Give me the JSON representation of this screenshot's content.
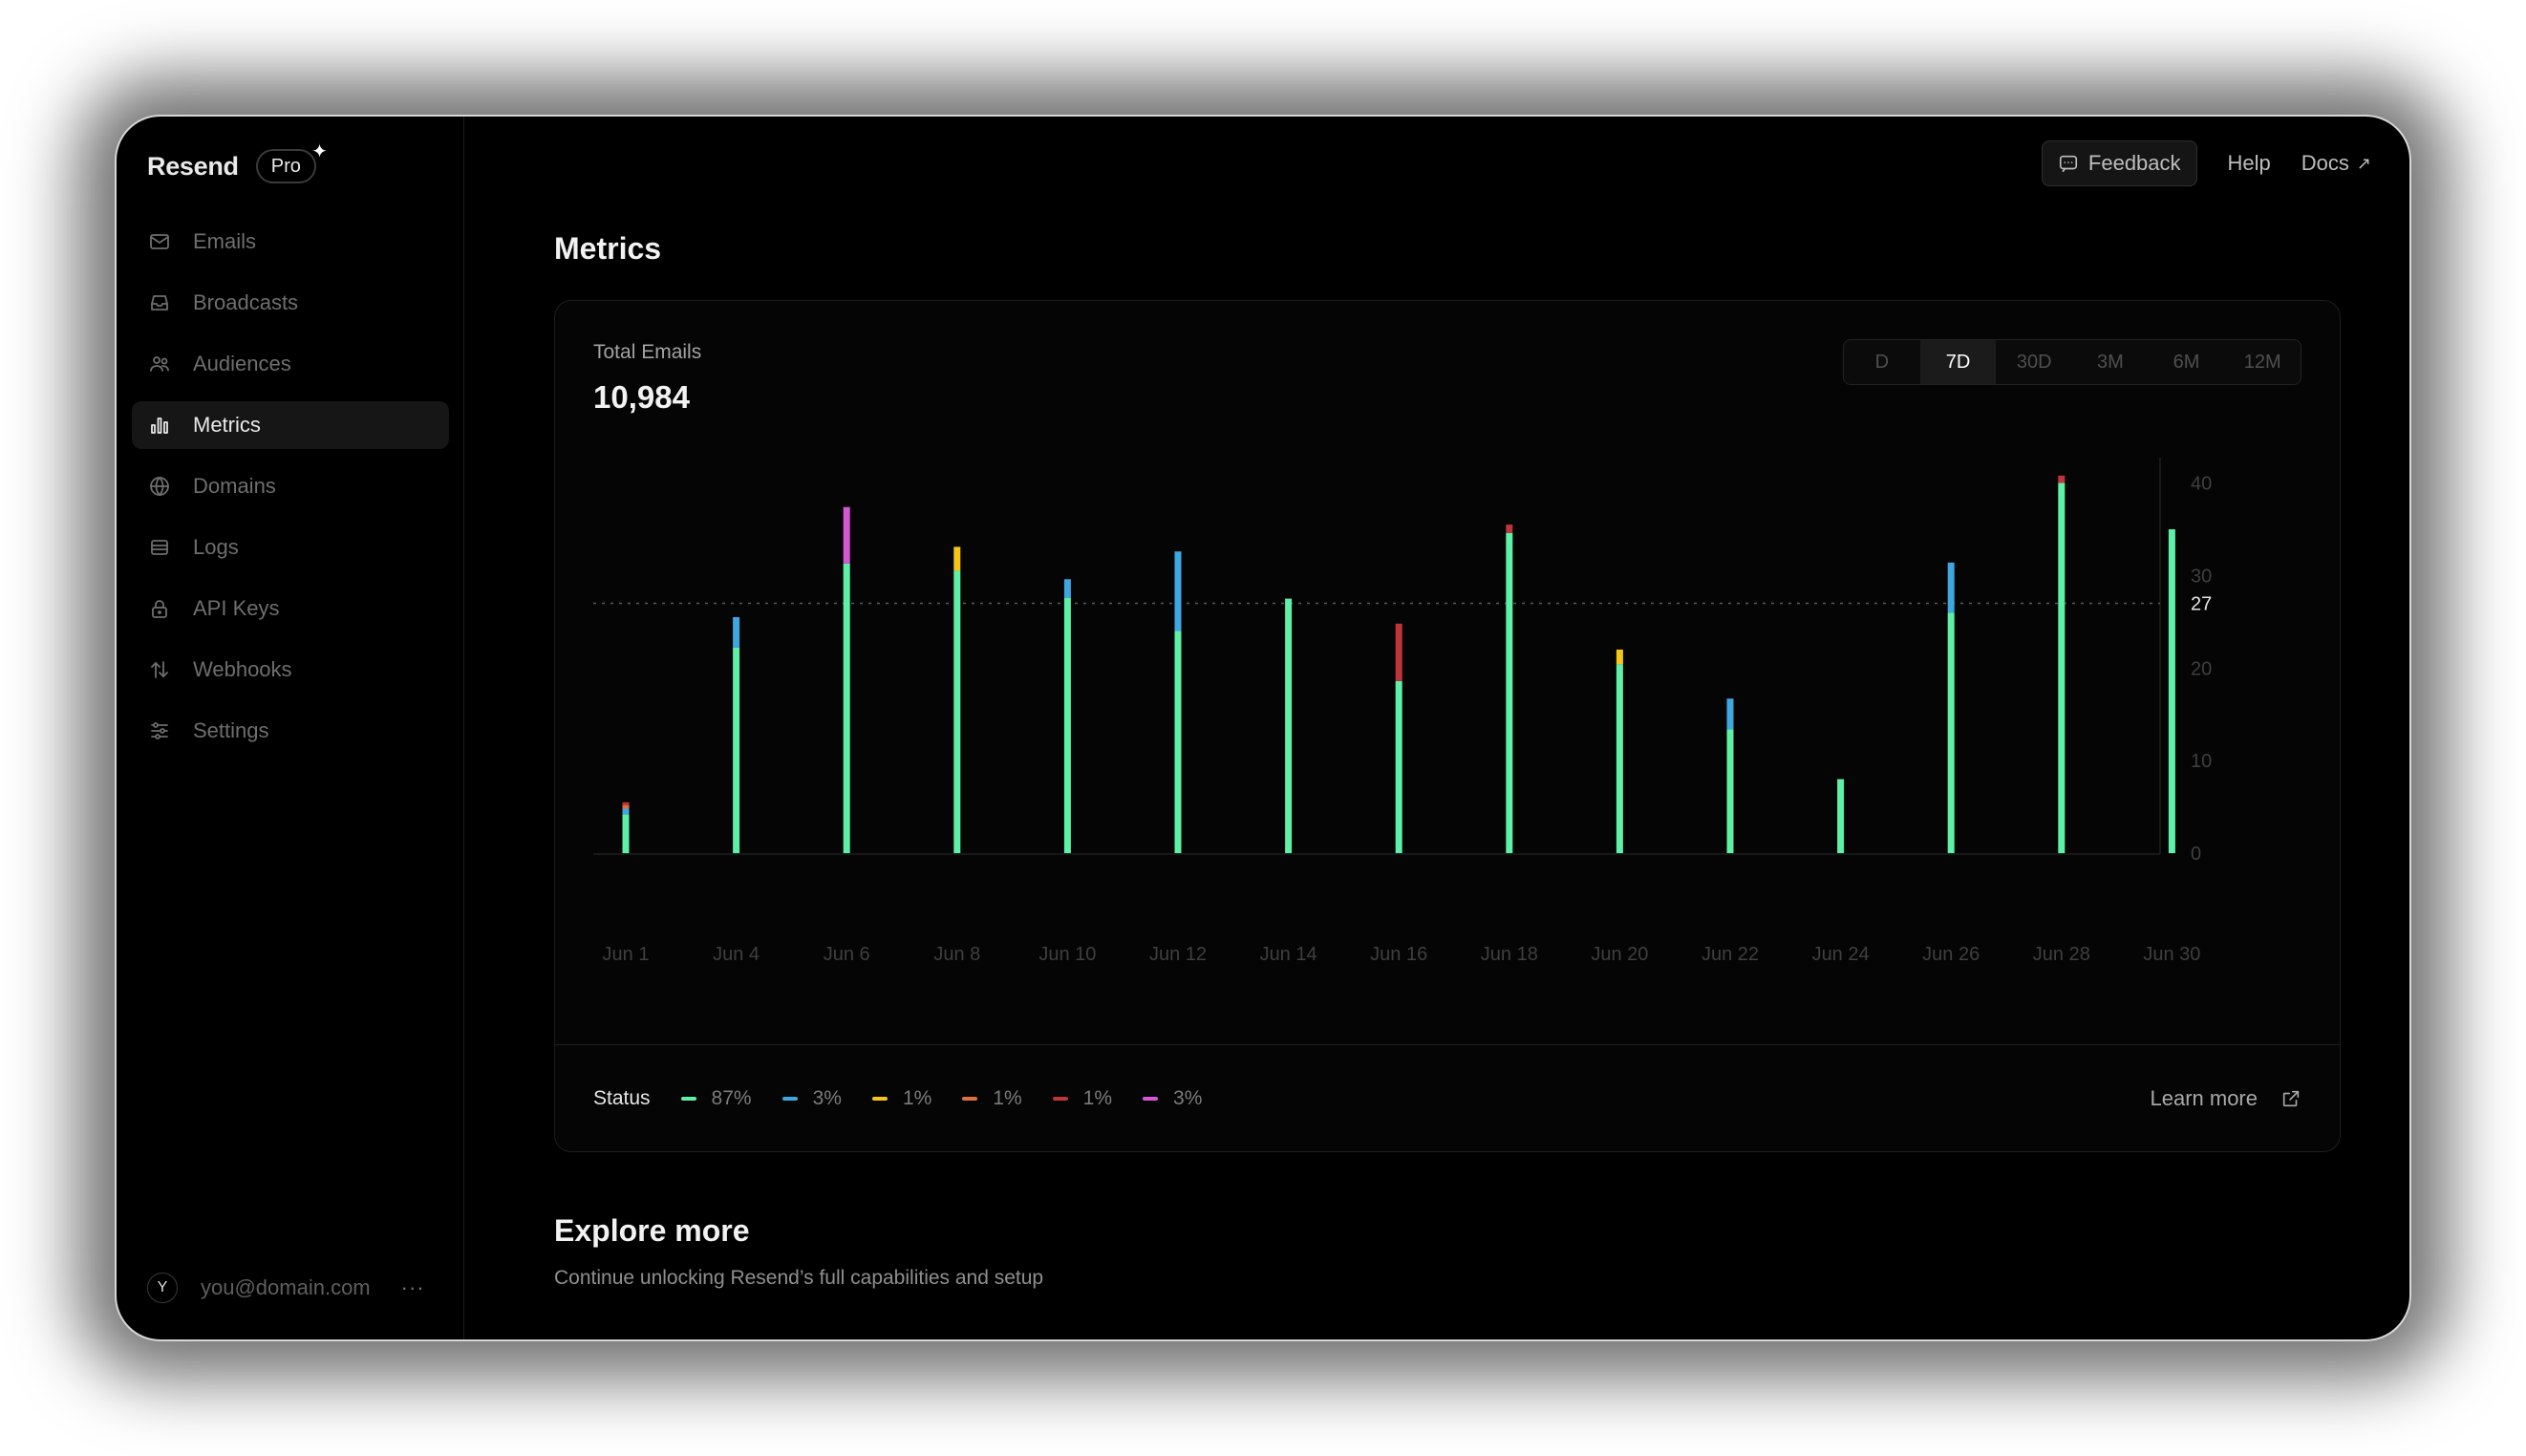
{
  "app": {
    "name": "Resend",
    "plan_badge": "Pro",
    "badge_spark_icon": "sparkle-icon"
  },
  "sidebar": {
    "items": [
      {
        "label": "Emails",
        "icon": "mail-icon",
        "active": false
      },
      {
        "label": "Broadcasts",
        "icon": "inbox-icon",
        "active": false
      },
      {
        "label": "Audiences",
        "icon": "users-icon",
        "active": false
      },
      {
        "label": "Metrics",
        "icon": "bar-chart-icon",
        "active": true
      },
      {
        "label": "Domains",
        "icon": "globe-icon",
        "active": false
      },
      {
        "label": "Logs",
        "icon": "list-icon",
        "active": false
      },
      {
        "label": "API Keys",
        "icon": "lock-icon",
        "active": false
      },
      {
        "label": "Webhooks",
        "icon": "arrows-up-down-icon",
        "active": false
      },
      {
        "label": "Settings",
        "icon": "sliders-icon",
        "active": false
      }
    ],
    "user": {
      "initial": "Y",
      "email": "you@domain.com",
      "more": "···"
    }
  },
  "topbar": {
    "feedback": "Feedback",
    "help": "Help",
    "docs": "Docs"
  },
  "page": {
    "title": "Metrics"
  },
  "card": {
    "label": "Total Emails",
    "value": "10,984",
    "ranges": [
      "D",
      "7D",
      "30D",
      "3M",
      "6M",
      "12M"
    ],
    "active_range": "7D"
  },
  "chart_data": {
    "type": "bar",
    "stacked": true,
    "categories": [
      "Jun 1",
      "Jun 4",
      "Jun 6",
      "Jun 8",
      "Jun 10",
      "Jun 12",
      "Jun 14",
      "Jun 16",
      "Jun 18",
      "Jun 20",
      "Jun 22",
      "Jun 24",
      "Jun 26",
      "Jun 28",
      "Jun 30"
    ],
    "xticks": [
      "Jun 1",
      "Jun 4",
      "Jun 6",
      "Jun 8",
      "Jun 10",
      "Jun 12",
      "Jun 14",
      "Jun 16",
      "Jun 18",
      "Jun 20",
      "Jun 22",
      "Jun 24",
      "Jun 26",
      "Jun 28",
      "Jun 30"
    ],
    "series": [
      {
        "color": "#5ff0a8",
        "values": [
          4.2,
          22.2,
          31.3,
          30.5,
          27.6,
          24.0,
          27.5,
          18.6,
          34.6,
          20.4,
          13.4,
          8.0,
          26.0,
          40.0,
          35.0
        ]
      },
      {
        "color": "#3ea7e0",
        "values": [
          0.6,
          3.3,
          0,
          0,
          2.0,
          8.6,
          0,
          0,
          0,
          0,
          3.3,
          0,
          5.4,
          0,
          0
        ]
      },
      {
        "color": "#f5c518",
        "values": [
          0,
          0,
          0,
          2.6,
          0,
          0,
          0,
          0,
          0,
          1.6,
          0,
          0,
          0,
          0,
          0
        ]
      },
      {
        "color": "#e0713c",
        "values": [
          0.4,
          0,
          0,
          0,
          0,
          0,
          0,
          0,
          0,
          0,
          0,
          0,
          0,
          0,
          0
        ]
      },
      {
        "color": "#c0353a",
        "values": [
          0.3,
          0,
          0,
          0,
          0,
          0,
          0,
          6.2,
          0.9,
          0,
          0,
          0,
          0,
          0.8,
          0
        ]
      },
      {
        "color": "#d458d4",
        "values": [
          0,
          0,
          6.1,
          0,
          0,
          0,
          0,
          0,
          0,
          0,
          0,
          0,
          0,
          0,
          0
        ]
      }
    ],
    "yticks": [
      0,
      10,
      20,
      30,
      40
    ],
    "ylim": [
      0,
      41.5
    ],
    "reference_line": {
      "value": 27,
      "label": "27"
    },
    "grid": false
  },
  "status": {
    "label": "Status",
    "items": [
      {
        "percent": "87%",
        "color": "#5ff0a8"
      },
      {
        "percent": "3%",
        "color": "#3ea7e0"
      },
      {
        "percent": "1%",
        "color": "#f5c518"
      },
      {
        "percent": "1%",
        "color": "#e0713c"
      },
      {
        "percent": "1%",
        "color": "#c0353a"
      },
      {
        "percent": "3%",
        "color": "#d458d4"
      }
    ],
    "learn_more": "Learn more"
  },
  "explore": {
    "title": "Explore more",
    "subtitle": "Continue unlocking Resend’s full capabilities and setup"
  }
}
